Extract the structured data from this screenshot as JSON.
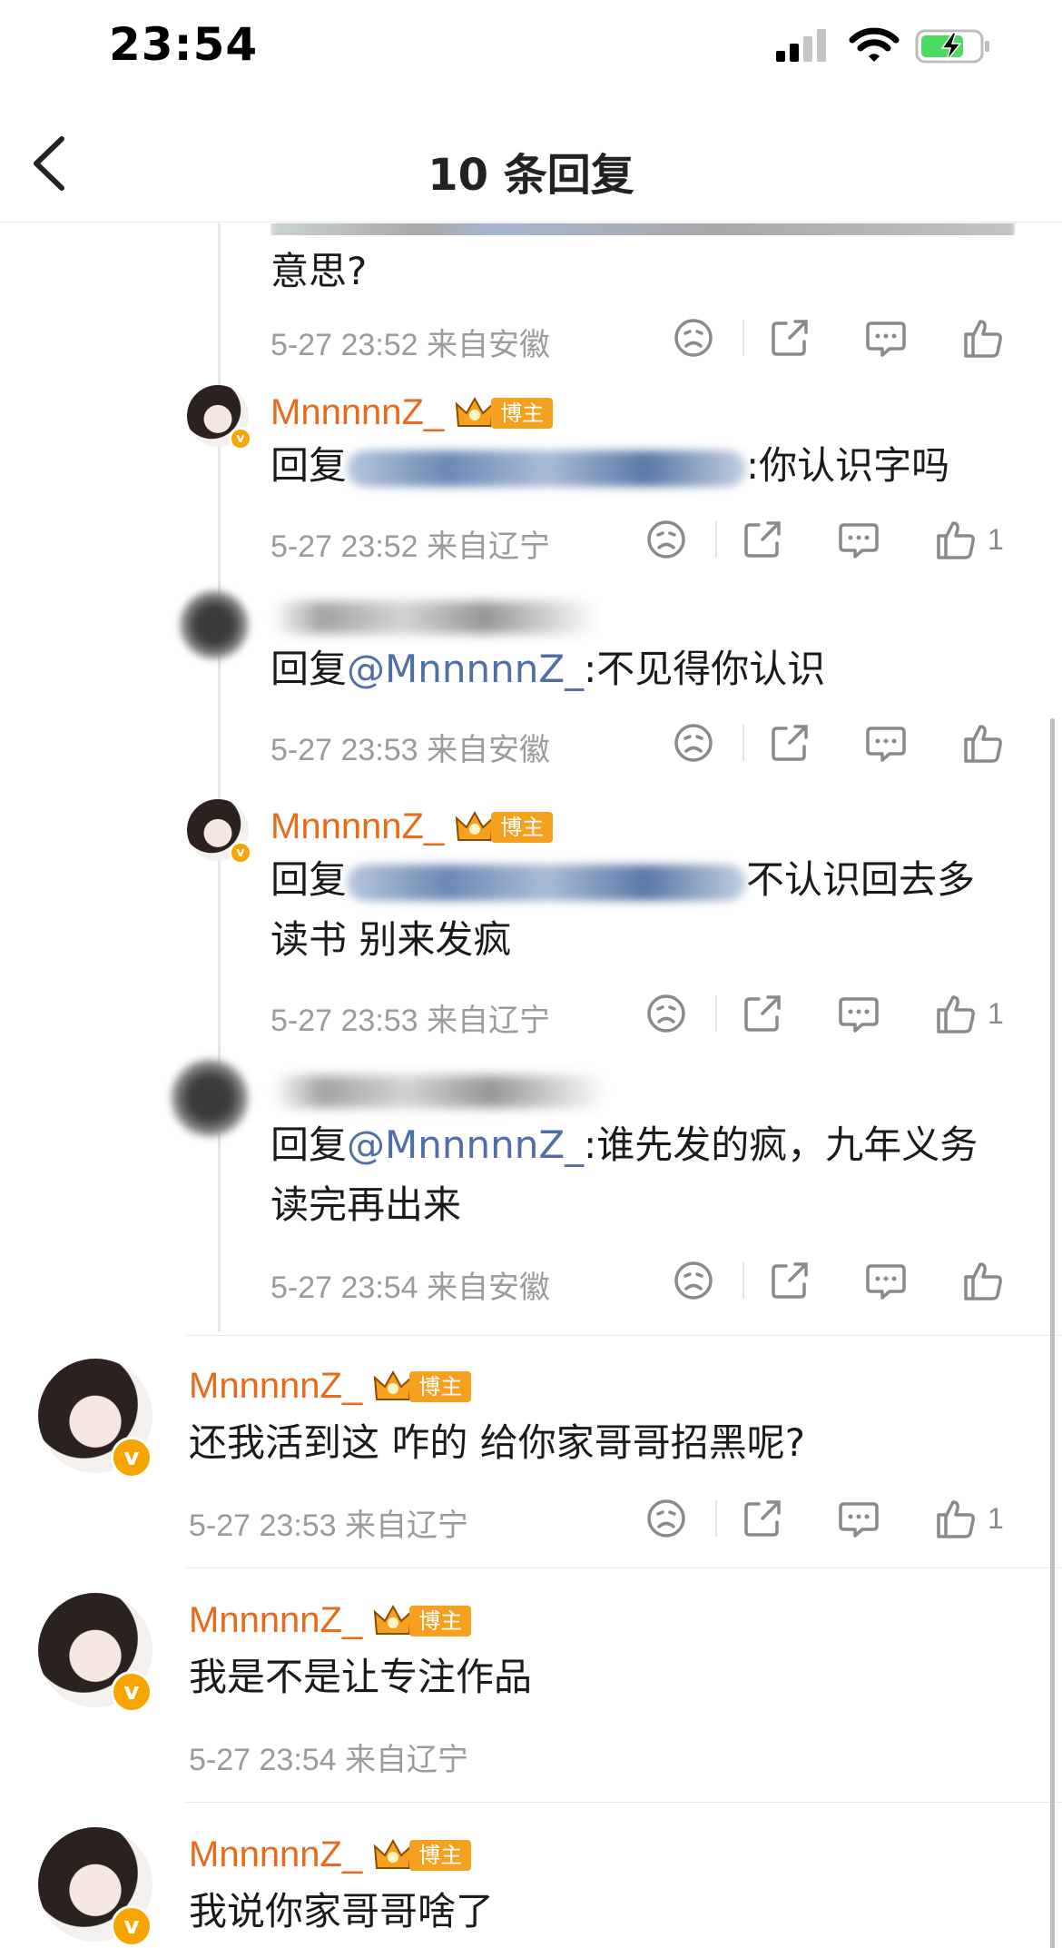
{
  "status_bar": {
    "time": "23:54"
  },
  "nav": {
    "title": "10 条回复"
  },
  "top_partial": {
    "text": "意思?",
    "meta": "5-27 23:52 来自安徽"
  },
  "replies": [
    {
      "author": "MnnnnnZ_",
      "badge": "博主",
      "prefix": "回复",
      "text": ":你认识字吗",
      "meta": "5-27 23:52 来自辽宁",
      "likes": "1"
    },
    {
      "prefix": "回复",
      "mention": "@MnnnnnZ_",
      "text": ":不见得你认识",
      "meta": "5-27 23:53 来自安徽"
    },
    {
      "author": "MnnnnnZ_",
      "badge": "博主",
      "prefix": "回复",
      "text": "不认识回去多",
      "text2": "读书 别来发疯",
      "meta": "5-27 23:53 来自辽宁",
      "likes": "1"
    },
    {
      "prefix": "回复",
      "mention": "@MnnnnnZ_",
      "text": ":谁先发的疯，九年义务",
      "text2": "读完再出来",
      "meta": "5-27 23:54 来自安徽"
    }
  ],
  "comments": [
    {
      "author": "MnnnnnZ_",
      "badge": "博主",
      "text": "还我活到这 咋的 给你家哥哥招黑呢?",
      "meta": "5-27 23:53 来自辽宁",
      "likes": "1"
    },
    {
      "author": "MnnnnnZ_",
      "badge": "博主",
      "text": "我是不是让专注作品",
      "meta": "5-27 23:54 来自辽宁"
    },
    {
      "author": "MnnnnnZ_",
      "badge": "博主",
      "text": "我说你家哥哥啥了"
    }
  ]
}
